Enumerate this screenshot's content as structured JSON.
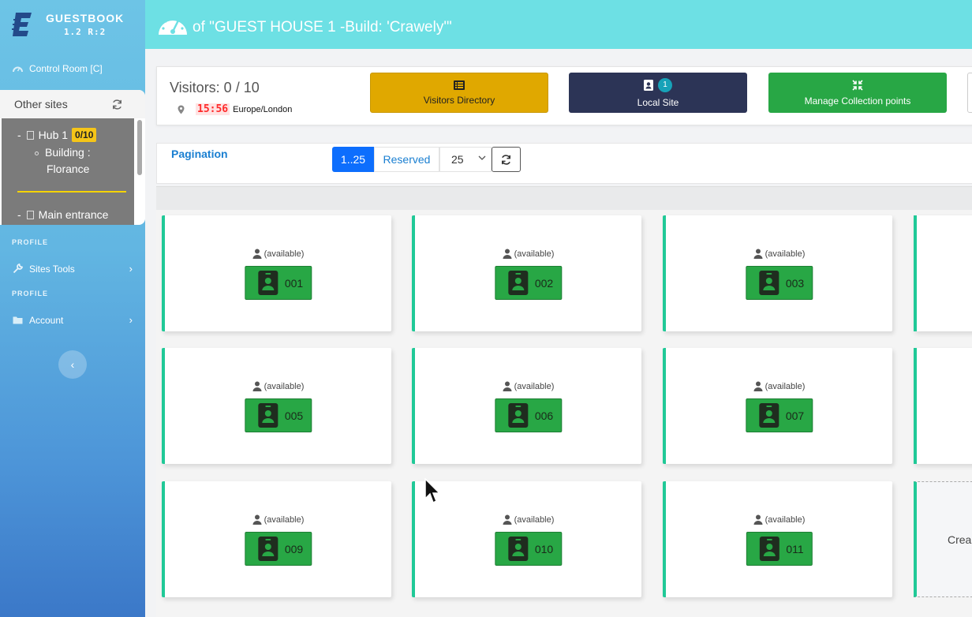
{
  "brand": {
    "title": "GUESTBOOK",
    "version": "1.2 R:2"
  },
  "sidebar": {
    "control_room": "Control Room [C]",
    "other_sites": {
      "title": "Other sites",
      "hub": {
        "label": "Hub 1",
        "count": "0/10"
      },
      "building": {
        "line1": "Building :",
        "line2": "Florance"
      },
      "main_entrance": "Main entrance"
    },
    "section_profile_1": "PROFILE",
    "sites_tools": "Sites Tools",
    "section_profile_2": "PROFILE",
    "account": "Account"
  },
  "header": {
    "title": "of \"GUEST HOUSE 1 -Build: 'Crawely'\""
  },
  "visitors": {
    "title": "Visitors: 0 / 10",
    "clock": "15:56",
    "timezone": "Europe/London"
  },
  "actions": {
    "directory": "Visitors Directory",
    "local_site": "Local Site",
    "local_site_count": "1",
    "manage": "Manage Collection points"
  },
  "pagination": {
    "label": "Pagination",
    "range": "1..25",
    "reserved": "Reserved",
    "page_size": "25"
  },
  "cards": [
    {
      "status": "(available)",
      "number": "001"
    },
    {
      "status": "(available)",
      "number": "002"
    },
    {
      "status": "(available)",
      "number": "003"
    },
    {
      "status": "(available)",
      "number": "005"
    },
    {
      "status": "(available)",
      "number": "006"
    },
    {
      "status": "(available)",
      "number": "007"
    },
    {
      "status": "(available)",
      "number": "009"
    },
    {
      "status": "(available)",
      "number": "010"
    },
    {
      "status": "(available)",
      "number": "011"
    }
  ],
  "create_card_label": "Crea",
  "colors": {
    "topbar": "#6de0e4",
    "directory_button": "#e0a800",
    "local_site_button": "#2c3456",
    "manage_button": "#28a745",
    "card_accent": "#20c997",
    "badge_green": "#28a745",
    "pagination_active": "#0d6efd"
  }
}
